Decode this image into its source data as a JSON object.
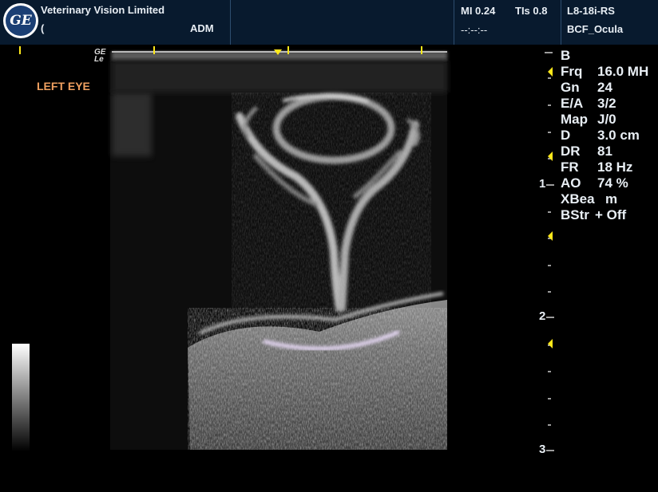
{
  "header": {
    "institution": "Veterinary Vision Limited",
    "patient_id": "(",
    "operator": "ADM",
    "mi": "MI 0.24",
    "tis": "TIs 0.8",
    "date_time": "--:--:--",
    "probe": "L8-18i-RS",
    "preset": "BCF_Ocula",
    "logo_text": "GE"
  },
  "image": {
    "label": "LEFT EYE",
    "ge_mark_line1": "GE",
    "ge_mark_line2": "Le",
    "label_color": "#f0a060",
    "marker_color": "#ffe81a"
  },
  "depth_scale": {
    "unit": "cm",
    "ticks": [
      "1",
      "2",
      "3"
    ]
  },
  "params": {
    "mode": "B",
    "rows": [
      {
        "name": "Frq",
        "value": "16.0 MH"
      },
      {
        "name": "Gn",
        "value": "24"
      },
      {
        "name": "E/A",
        "value": "3/2"
      },
      {
        "name": "Map",
        "value": "J/0"
      },
      {
        "name": "D",
        "value": "3.0 cm"
      },
      {
        "name": "DR",
        "value": "81"
      },
      {
        "name": "FR",
        "value": "18 Hz"
      },
      {
        "name": "AO",
        "value": "74 %"
      },
      {
        "name": "XBea",
        "value": "m"
      },
      {
        "name": "BStr",
        "value": "+ Off"
      }
    ]
  }
}
